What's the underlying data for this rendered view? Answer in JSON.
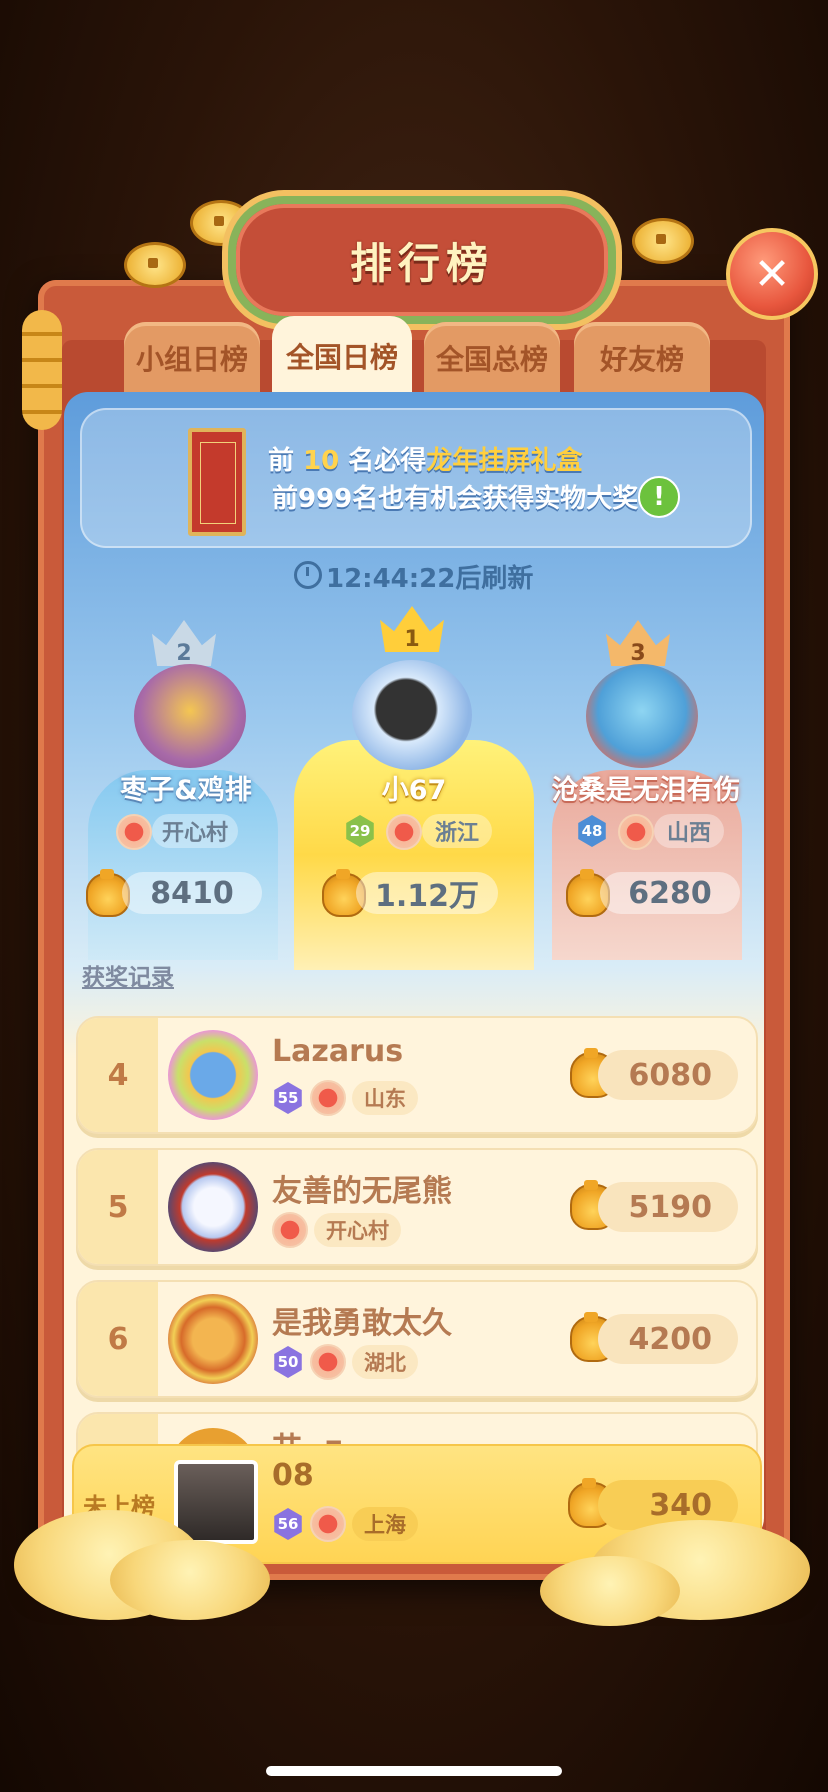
{
  "header": {
    "title": "排行榜",
    "close_label": "✕"
  },
  "tabs": [
    {
      "label": "小组日榜",
      "active": false
    },
    {
      "label": "全国日榜",
      "active": true
    },
    {
      "label": "全国总榜",
      "active": false
    },
    {
      "label": "好友榜",
      "active": false
    }
  ],
  "notice": {
    "line1_prefix": "前 ",
    "line1_number": "10",
    "line1_middle": " 名必得",
    "line1_prize": "龙年挂屏礼盒",
    "line2": "前999名也有机会获得实物大奖",
    "info_icon": "!"
  },
  "refresh_text": "12:44:22后刷新",
  "top3": [
    {
      "rank": "2",
      "name": "枣子&鸡排",
      "region": "开心村",
      "level": "",
      "score": "8410"
    },
    {
      "rank": "1",
      "name": "小67",
      "region": "浙江",
      "level": "29",
      "score": "1.12万"
    },
    {
      "rank": "3",
      "name": "沧桑是无泪有伤",
      "region": "山西",
      "level": "48",
      "score": "6280"
    }
  ],
  "awards_link": "获奖记录",
  "rows": [
    {
      "rank": "4",
      "name": "Lazarus",
      "level": "55",
      "region": "山东",
      "score": "6080"
    },
    {
      "rank": "5",
      "name": "友善的无尾熊",
      "level": "",
      "region": "开心村",
      "score": "5190"
    },
    {
      "rank": "6",
      "name": "是我勇敢太久",
      "level": "50",
      "region": "湖北",
      "score": "4200"
    }
  ],
  "self": {
    "rank_label": "未上榜",
    "name": "08",
    "level": "56",
    "region": "上海",
    "score": "340"
  },
  "partial_row_name": "艹 -z",
  "colors": {
    "frame": "#c95a3a",
    "tab_active": "#fff4db",
    "tab_inactive": "#e39a64",
    "row_bg": "#fff4dc",
    "gold": "#ffd454"
  },
  "icons": [
    "close-icon",
    "clock-icon",
    "scroll-prize-icon",
    "money-bag-icon",
    "crown-icon",
    "region-badge-icon",
    "level-badge-icon"
  ]
}
